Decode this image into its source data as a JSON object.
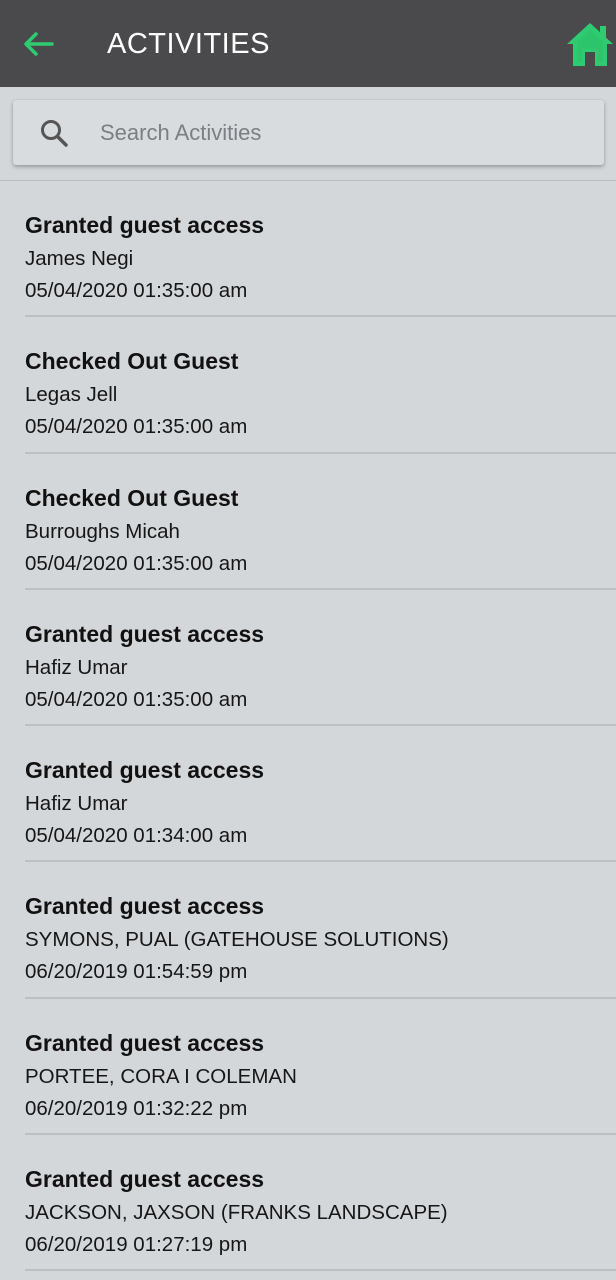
{
  "header": {
    "title": "ACTIVITIES",
    "back_icon": "arrow-left-icon",
    "home_icon": "home-icon",
    "accent_color": "#2ecc71"
  },
  "search": {
    "placeholder": "Search Activities",
    "value": ""
  },
  "activities": [
    {
      "action": "Granted guest access",
      "name": "James Negi",
      "time": "05/04/2020 01:35:00 am"
    },
    {
      "action": "Checked Out Guest",
      "name": "Legas Jell",
      "time": "05/04/2020 01:35:00 am"
    },
    {
      "action": "Checked Out Guest",
      "name": "Burroughs Micah",
      "time": "05/04/2020 01:35:00 am"
    },
    {
      "action": "Granted guest access",
      "name": "Hafiz Umar",
      "time": "05/04/2020 01:35:00 am"
    },
    {
      "action": "Granted guest access",
      "name": "Hafiz Umar",
      "time": "05/04/2020 01:34:00 am"
    },
    {
      "action": "Granted guest access",
      "name": "SYMONS, PUAL (GATEHOUSE SOLUTIONS)",
      "time": "06/20/2019 01:54:59 pm"
    },
    {
      "action": "Granted guest access",
      "name": "PORTEE, CORA I COLEMAN",
      "time": "06/20/2019 01:32:22 pm"
    },
    {
      "action": "Granted guest access",
      "name": "JACKSON, JAXSON (FRANKS LANDSCAPE)",
      "time": "06/20/2019 01:27:19 pm"
    }
  ]
}
